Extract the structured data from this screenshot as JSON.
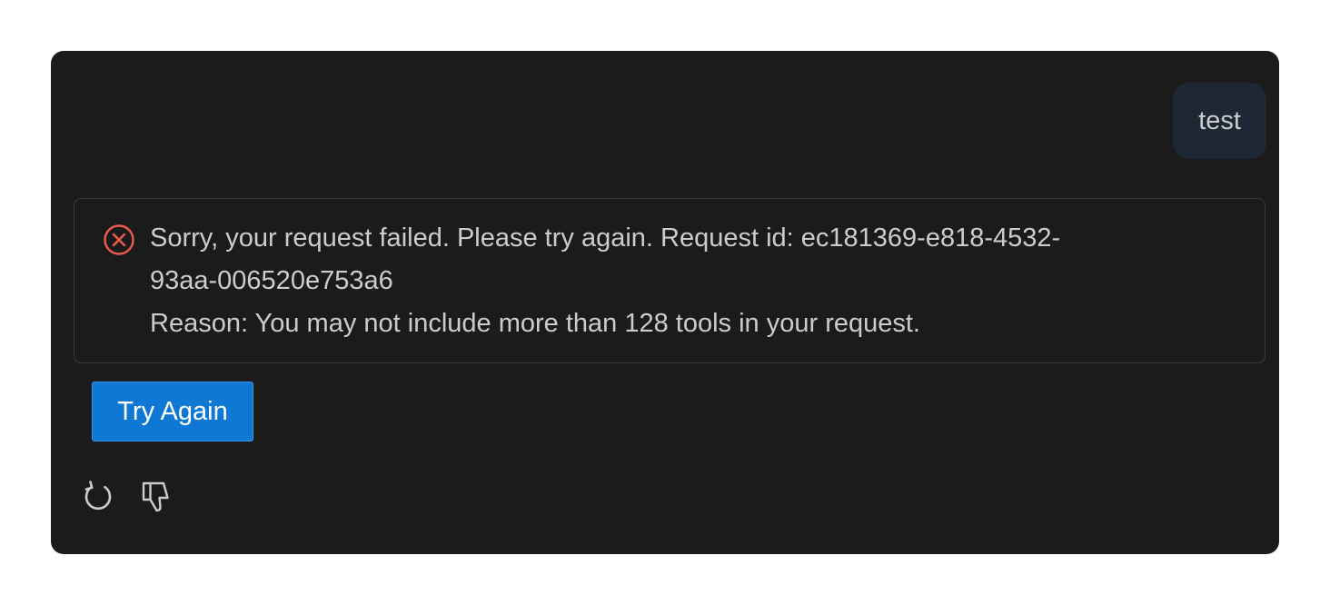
{
  "chat": {
    "user_message": "test",
    "error": {
      "icon": "error-circle-x-icon",
      "line1": "Sorry, your request failed. Please try again. Request id: ec181369-e818-4532-",
      "line2": "93aa-006520e753a6",
      "line3": "Reason: You may not include more than 128 tools in your request."
    },
    "try_again_label": "Try Again",
    "actions": [
      {
        "icon": "retry-icon"
      },
      {
        "icon": "thumbs-down-icon"
      }
    ]
  },
  "colors": {
    "panel_bg": "#1b1b1b",
    "user_bubble_bg": "#1e2835",
    "error_icon": "#f05b4f",
    "button_bg": "#0e78d4",
    "text": "#cccccc"
  }
}
